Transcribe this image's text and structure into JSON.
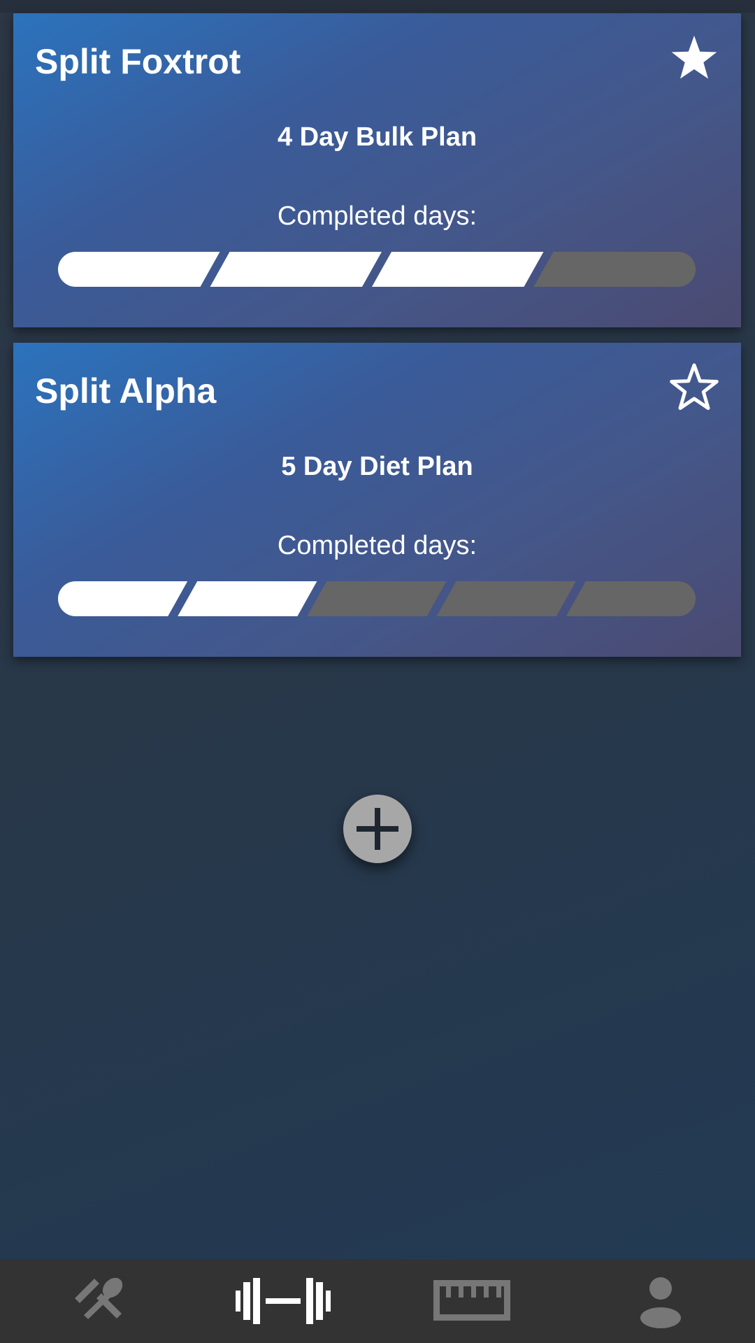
{
  "splits": [
    {
      "title": "Split Foxtrot",
      "favorite": true,
      "favorite_icon": "star-filled-icon",
      "plan": "4 Day Bulk Plan",
      "completed_label": "Completed days:",
      "total_days": 4,
      "completed_days": 3
    },
    {
      "title": "Split Alpha",
      "favorite": false,
      "favorite_icon": "star-outline-icon",
      "plan": "5 Day Diet Plan",
      "completed_label": "Completed days:",
      "total_days": 5,
      "completed_days": 2
    }
  ],
  "add_button": {
    "icon": "plus-icon"
  },
  "nav": {
    "items": [
      {
        "icon": "fork-spoon-icon",
        "active": false
      },
      {
        "icon": "barbell-icon",
        "active": true
      },
      {
        "icon": "ruler-icon",
        "active": false
      },
      {
        "icon": "person-icon",
        "active": false
      }
    ]
  },
  "colors": {
    "card_gradient_start": "#2b73bd",
    "card_gradient_end": "#4b4a71",
    "progress_done": "#ffffff",
    "progress_todo": "#666666",
    "nav_active": "#ffffff",
    "nav_inactive": "#777777",
    "nav_background": "#333333"
  }
}
